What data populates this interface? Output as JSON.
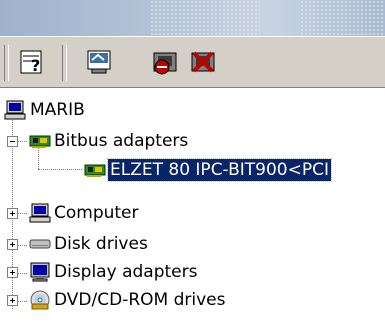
{
  "toolbar": {
    "buttons": [
      {
        "name": "help-icon"
      },
      {
        "name": "properties-icon"
      },
      {
        "name": "disable-device-icon"
      },
      {
        "name": "uninstall-device-icon"
      }
    ]
  },
  "tree": {
    "root": {
      "label": "MARIB",
      "icon": "computer-icon"
    },
    "nodes": [
      {
        "label": "Bitbus adapters",
        "icon": "network-card-icon",
        "expanded": true,
        "children": [
          {
            "label": "ELZET 80 IPC-BIT900<PCI",
            "icon": "network-card-icon",
            "selected": true
          }
        ]
      },
      {
        "label": "Computer",
        "icon": "computer-icon",
        "expanded": false
      },
      {
        "label": "Disk drives",
        "icon": "disk-drive-icon",
        "expanded": false
      },
      {
        "label": "Display adapters",
        "icon": "monitor-icon",
        "expanded": false
      },
      {
        "label": "DVD/CD-ROM drives",
        "icon": "cdrom-icon",
        "expanded": false
      }
    ]
  },
  "colors": {
    "selection_bg": "#0a246a",
    "selection_fg": "#ffffff",
    "toolbar_bg": "#d4d0c8"
  }
}
